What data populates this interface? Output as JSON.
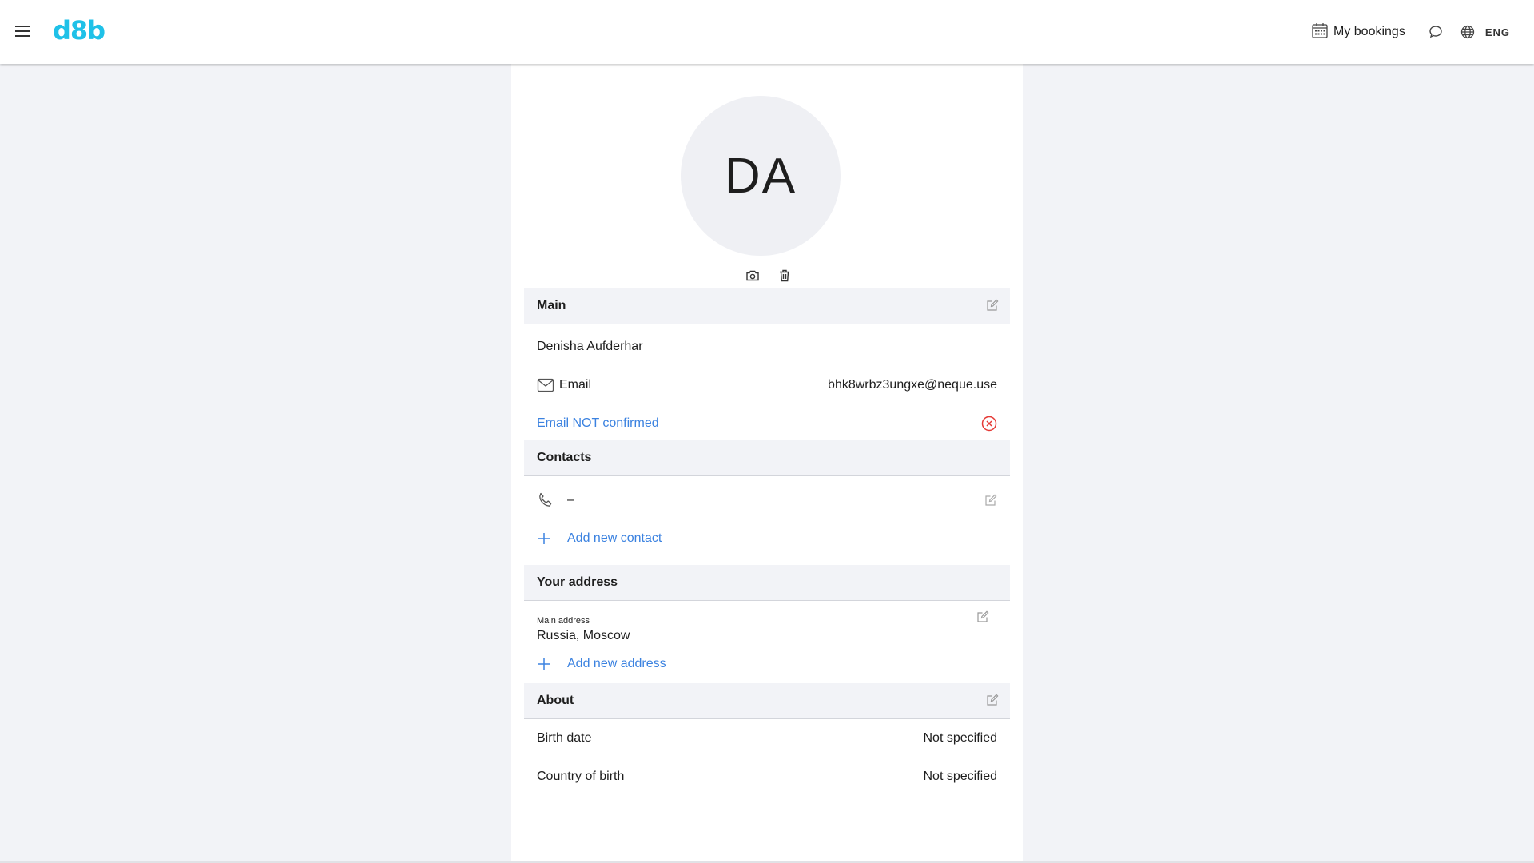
{
  "header": {
    "logo": "d8b",
    "my_bookings": "My bookings",
    "language": "ENG"
  },
  "profile": {
    "initials": "DA"
  },
  "main": {
    "title": "Main",
    "name": "Denisha Aufderhar",
    "email_label": "Email",
    "email_value": "bhk8wrbz3ungxe@neque.use",
    "email_status": "Email NOT confirmed"
  },
  "contacts": {
    "title": "Contacts",
    "phone_value": "–",
    "add_label": "Add new contact"
  },
  "address": {
    "title": "Your address",
    "main_label": "Main address",
    "main_value": "Russia, Moscow",
    "add_label": "Add new address"
  },
  "about": {
    "title": "About",
    "birth_date_label": "Birth date",
    "birth_date_value": "Not specified",
    "country_label": "Country of birth",
    "country_value": "Not specified"
  },
  "colors": {
    "accent": "#3b82e0",
    "logo": "#1fc1e8",
    "error": "#e53935"
  }
}
